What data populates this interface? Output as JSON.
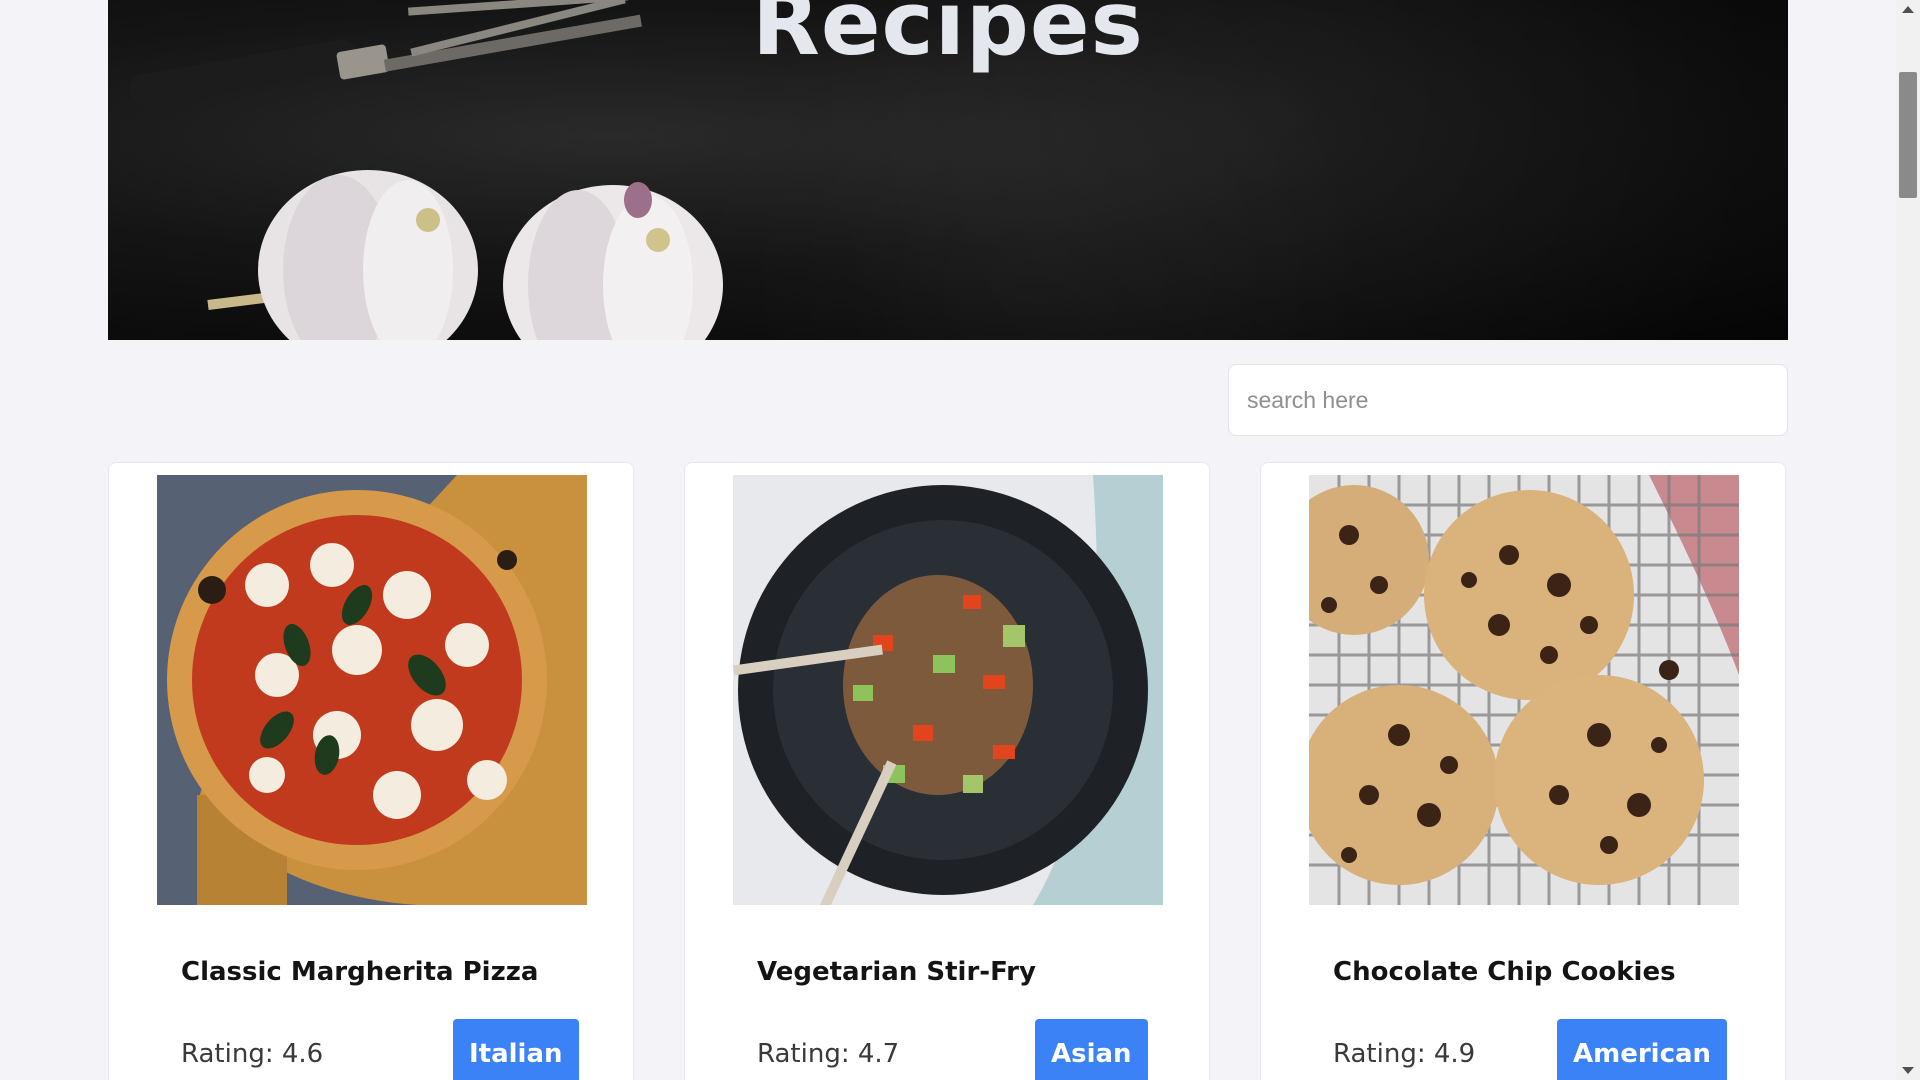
{
  "hero": {
    "title": "Recipes"
  },
  "search": {
    "placeholder": "search here",
    "value": ""
  },
  "recipes": [
    {
      "title": "Classic Margherita Pizza",
      "rating_text": "Rating: 4.6",
      "cuisine": "Italian",
      "image_icon": "pizza-image"
    },
    {
      "title": "Vegetarian Stir-Fry",
      "rating_text": "Rating: 4.7",
      "cuisine": "Asian",
      "image_icon": "stir-fry-image"
    },
    {
      "title": "Chocolate Chip Cookies",
      "rating_text": "Rating: 4.9",
      "cuisine": "American",
      "image_icon": "cookies-image"
    }
  ],
  "colors": {
    "page_background": "#f4f4f8",
    "accent": "#3b82f6",
    "hero_background": "#0b0b0b",
    "hero_title": "#e4e7ee"
  }
}
